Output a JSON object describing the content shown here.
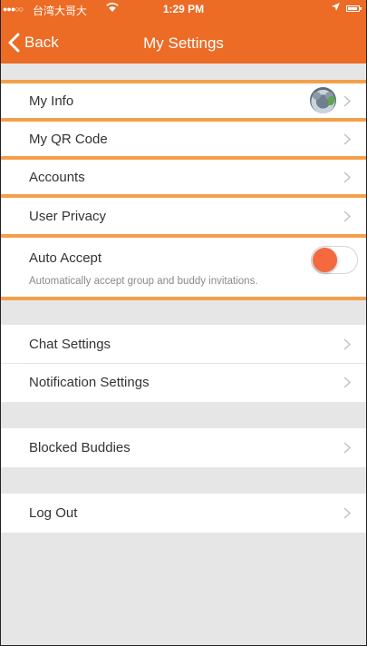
{
  "status_bar": {
    "signal": "●●●○○",
    "carrier": "台湾大哥大",
    "time": "1:29 PM"
  },
  "nav": {
    "back_label": "Back",
    "title": "My Settings"
  },
  "rows": {
    "my_info": "My Info",
    "my_qr_code": "My QR Code",
    "accounts": "Accounts",
    "user_privacy": "User Privacy",
    "auto_accept": "Auto Accept",
    "auto_accept_desc": "Automatically accept group and buddy invitations.",
    "chat_settings": "Chat Settings",
    "notification_settings": "Notification Settings",
    "blocked_buddies": "Blocked Buddies",
    "log_out": "Log Out"
  },
  "auto_accept_enabled": false,
  "colors": {
    "header": "#ec6b25",
    "highlight_lines": "#f4a04a",
    "toggle_knob": "#f46a3e",
    "background": "#e6e6e6"
  },
  "icons": [
    "chevron-left-icon",
    "wifi-icon",
    "location-arrow-icon",
    "battery-icon",
    "chevron-right-icon"
  ]
}
